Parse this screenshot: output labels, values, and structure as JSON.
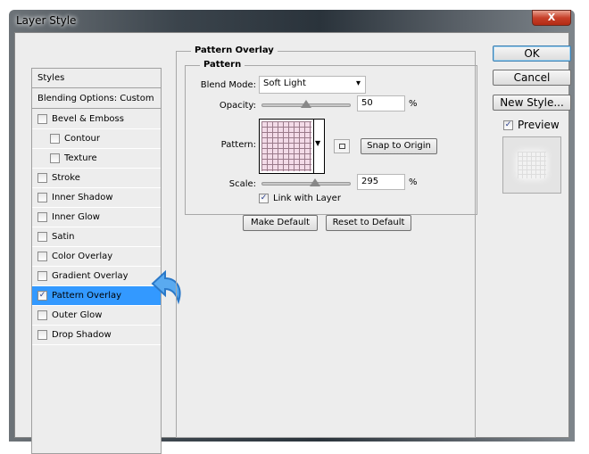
{
  "window": {
    "title": "Layer Style",
    "close_label": "X"
  },
  "sidebar": {
    "header": "Styles",
    "blending": "Blending Options: Custom",
    "items": [
      {
        "label": "Bevel & Emboss",
        "checked": false,
        "sub": false
      },
      {
        "label": "Contour",
        "checked": false,
        "sub": true
      },
      {
        "label": "Texture",
        "checked": false,
        "sub": true
      },
      {
        "label": "Stroke",
        "checked": false,
        "sub": false
      },
      {
        "label": "Inner Shadow",
        "checked": false,
        "sub": false
      },
      {
        "label": "Inner Glow",
        "checked": false,
        "sub": false
      },
      {
        "label": "Satin",
        "checked": false,
        "sub": false
      },
      {
        "label": "Color Overlay",
        "checked": false,
        "sub": false
      },
      {
        "label": "Gradient Overlay",
        "checked": false,
        "sub": false
      },
      {
        "label": "Pattern Overlay",
        "checked": true,
        "sub": false,
        "selected": true
      },
      {
        "label": "Outer Glow",
        "checked": false,
        "sub": false
      },
      {
        "label": "Drop Shadow",
        "checked": false,
        "sub": false
      }
    ]
  },
  "panel": {
    "title": "Pattern Overlay",
    "group": "Pattern",
    "blend_mode_label": "Blend Mode:",
    "blend_mode": "Soft Light",
    "opacity_label": "Opacity:",
    "opacity": "50",
    "opacity_unit": "%",
    "pattern_label": "Pattern:",
    "snap_label": "Snap to Origin",
    "scale_label": "Scale:",
    "scale": "295",
    "scale_unit": "%",
    "link_label": "Link with Layer",
    "link_checked": true,
    "make_default": "Make Default",
    "reset_default": "Reset to Default"
  },
  "buttons": {
    "ok": "OK",
    "cancel": "Cancel",
    "new_style": "New Style...",
    "preview": "Preview",
    "preview_checked": true
  },
  "colors": {
    "selection": "#3399ff",
    "dialog_bg": "#ededed"
  }
}
